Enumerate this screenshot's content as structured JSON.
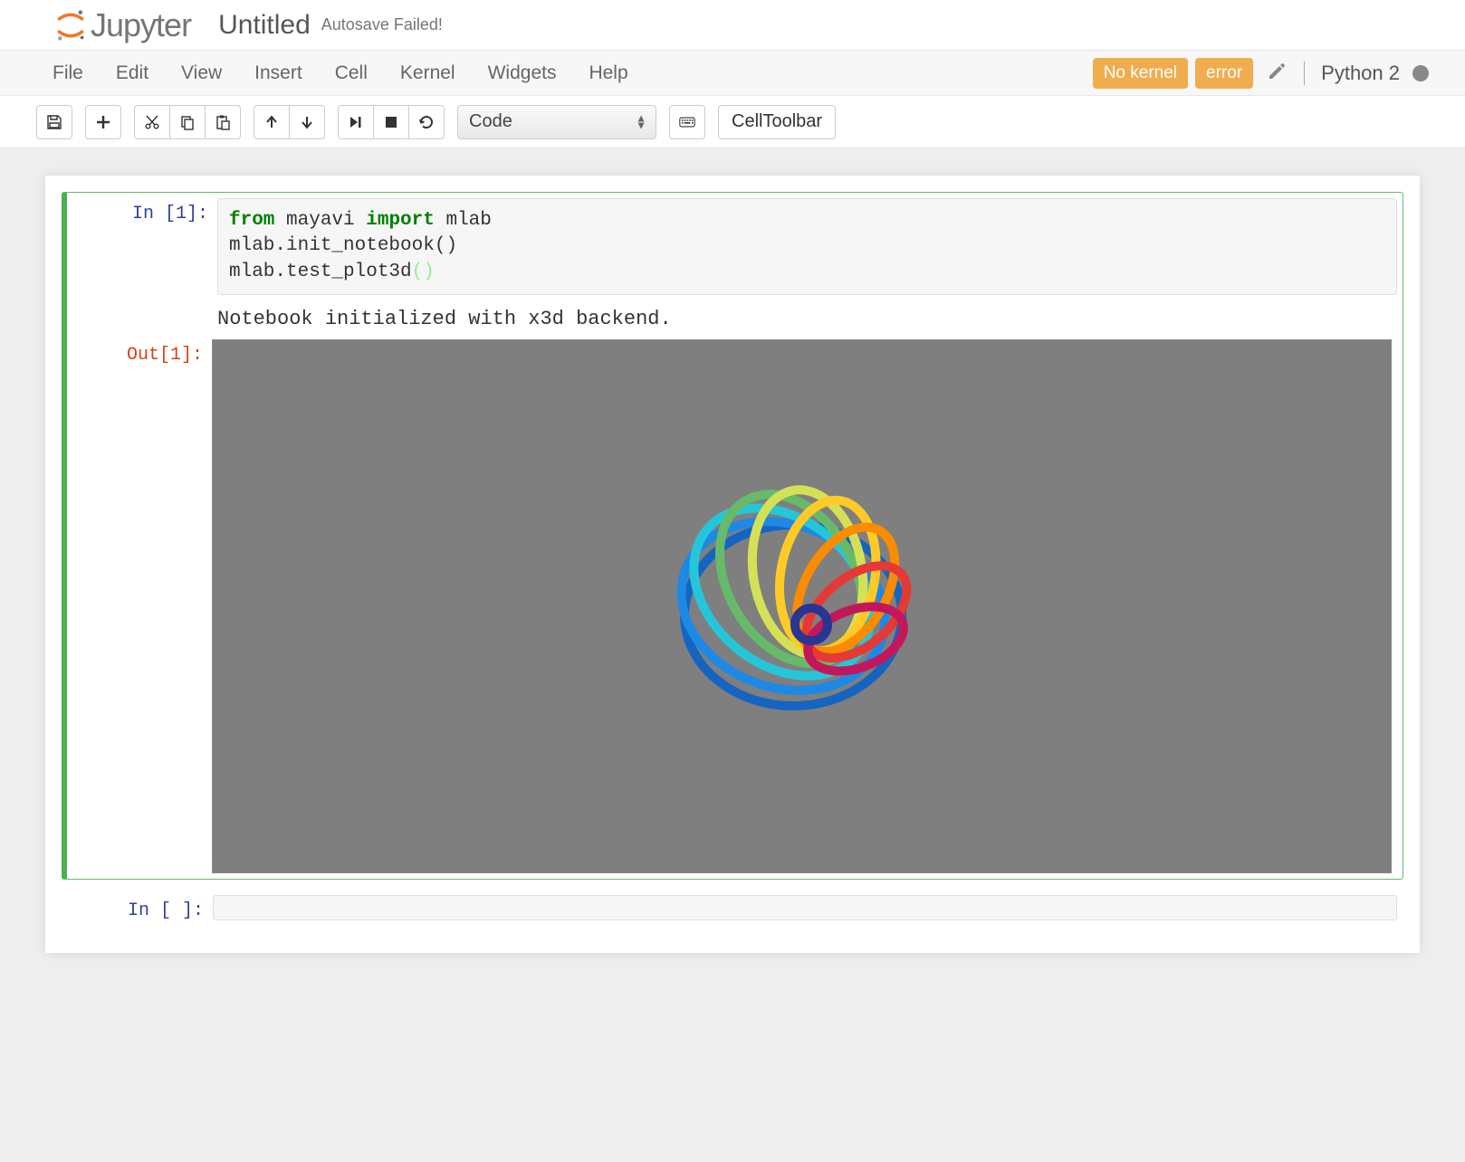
{
  "header": {
    "logo_text": "Jupyter",
    "notebook_name": "Untitled",
    "autosave_status": "Autosave Failed!"
  },
  "menubar": {
    "menus": [
      "File",
      "Edit",
      "View",
      "Insert",
      "Cell",
      "Kernel",
      "Widgets",
      "Help"
    ],
    "status_nokernel": "No kernel",
    "status_error": "error",
    "kernel_name": "Python 2"
  },
  "toolbar": {
    "cell_type_selected": "Code",
    "cell_toolbar_label": "CellToolbar"
  },
  "cells": [
    {
      "exec_count": 1,
      "prompt_in": "In [1]:",
      "prompt_out": "Out[1]:",
      "source_tokens": [
        {
          "t": "from",
          "c": "kw-green"
        },
        {
          "t": " mayavi ",
          "c": ""
        },
        {
          "t": "import",
          "c": "kw-green"
        },
        {
          "t": " mlab\n",
          "c": ""
        },
        {
          "t": "mlab.init_notebook()\n",
          "c": ""
        },
        {
          "t": "mlab.test_plot3d",
          "c": ""
        },
        {
          "t": "(",
          "c": "kw-paren-light"
        },
        {
          "t": ")",
          "c": "kw-paren-light"
        }
      ],
      "stdout": "Notebook initialized with x3d backend."
    },
    {
      "exec_count": null,
      "prompt_in": "In [ ]:",
      "source_tokens": []
    }
  ]
}
